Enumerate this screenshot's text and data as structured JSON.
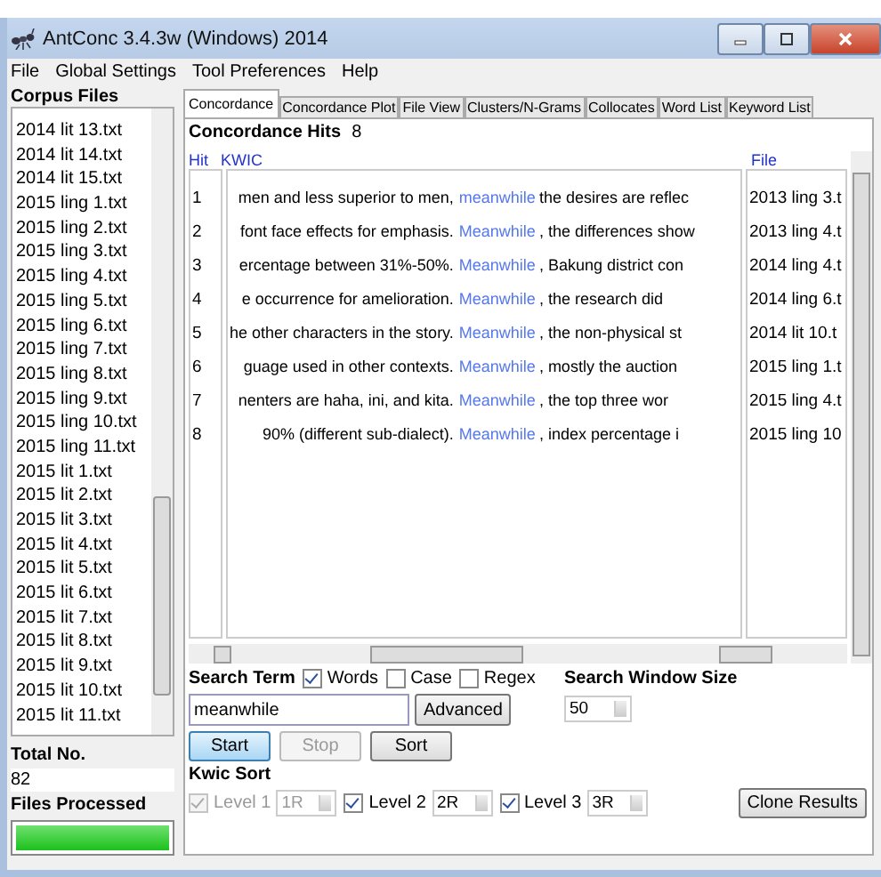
{
  "window": {
    "title": "AntConc 3.4.3w (Windows) 2014"
  },
  "menu": [
    "File",
    "Global Settings",
    "Tool Preferences",
    "Help"
  ],
  "corpus": {
    "label": "Corpus Files",
    "files": [
      "2014 lit 13.txt",
      "2014 lit 14.txt",
      "2014 lit 15.txt",
      "2015 ling 1.txt",
      "2015 ling 2.txt",
      "2015 ling 3.txt",
      "2015 ling 4.txt",
      "2015 ling 5.txt",
      "2015 ling 6.txt",
      "2015 ling 7.txt",
      "2015 ling 8.txt",
      "2015 ling 9.txt",
      "2015 ling 10.txt",
      "2015 ling 11.txt",
      "2015 lit 1.txt",
      "2015 lit 2.txt",
      "2015 lit 3.txt",
      "2015 lit 4.txt",
      "2015 lit 5.txt",
      "2015 lit 6.txt",
      "2015 lit 7.txt",
      "2015 lit 8.txt",
      "2015 lit 9.txt",
      "2015 lit 10.txt",
      "2015 lit 11.txt"
    ],
    "total_label": "Total No.",
    "total": "82",
    "processed_label": "Files Processed",
    "progress": {
      "level": 1
    }
  },
  "tabs": [
    {
      "label": "Concordance",
      "selected": true
    },
    {
      "label": "Concordance Plot",
      "selected": false
    },
    {
      "label": "File View",
      "selected": false
    },
    {
      "label": "Clusters/N-Grams",
      "selected": false
    },
    {
      "label": "Collocates",
      "selected": false
    },
    {
      "label": "Word List",
      "selected": false
    },
    {
      "label": "Keyword List",
      "selected": false
    }
  ],
  "hits": {
    "label": "Concordance Hits",
    "count": "8"
  },
  "table": {
    "columns": [
      "Hit",
      "KWIC",
      "File"
    ],
    "rows": [
      {
        "hit": "1",
        "left": "men and less superior to men,",
        "keyword": "meanwhile",
        "right": "the desires are reflec",
        "file": "2013 ling 3.t"
      },
      {
        "hit": "2",
        "left": "font face effects for emphasis.",
        "keyword": "Meanwhile",
        "right": ", the differences show",
        "file": "2013 ling 4.t"
      },
      {
        "hit": "3",
        "left": "ercentage  between  31%-50%.",
        "keyword": "Meanwhile",
        "right": ",  Bakung  district con",
        "file": "2014 ling 4.t"
      },
      {
        "hit": "4",
        "left": "e  occurrence  for amelioration.",
        "keyword": "Meanwhile",
        "right": ",  the  research  did",
        "file": "2014 ling 6.t"
      },
      {
        "hit": "5",
        "left": "he other characters in the story.",
        "keyword": "Meanwhile",
        "right": ", the  non-physical st",
        "file": "2014 lit 10.t"
      },
      {
        "hit": "6",
        "left": "guage  used  in  other  contexts.",
        "keyword": "Meanwhile",
        "right": ", mostly  the  auction",
        "file": "2015 ling 1.t"
      },
      {
        "hit": "7",
        "left": "nenters  are haha,  ini, and kita.",
        "keyword": "Meanwhile",
        "right": ",  the  top  three  wor",
        "file": "2015 ling 4.t"
      },
      {
        "hit": "8",
        "left": "90%  (different  sub-dialect).",
        "keyword": "Meanwhile",
        "right": ",  index  percentage  i",
        "file": "2015 ling 10"
      }
    ]
  },
  "search": {
    "label": "Search Term",
    "options": [
      {
        "label": "Words",
        "checked": true
      },
      {
        "label": "Case",
        "checked": false
      },
      {
        "label": "Regex",
        "checked": false
      }
    ],
    "value": "meanwhile",
    "advanced": "Advanced",
    "window_label": "Search Window Size",
    "window_size": "50"
  },
  "buttons": [
    {
      "label": "Start",
      "selected": true,
      "disabled": false
    },
    {
      "label": "Stop",
      "selected": false,
      "disabled": true
    },
    {
      "label": "Sort",
      "selected": false,
      "disabled": false
    }
  ],
  "kwic_sort": {
    "label": "Kwic Sort",
    "levels": [
      {
        "label": "Level 1",
        "checked": true,
        "disabled": true,
        "value": "1R"
      },
      {
        "label": "Level 2",
        "checked": true,
        "disabled": false,
        "value": "2R"
      },
      {
        "label": "Level 3",
        "checked": true,
        "disabled": false,
        "value": "3R"
      }
    ]
  },
  "clone": "Clone Results"
}
